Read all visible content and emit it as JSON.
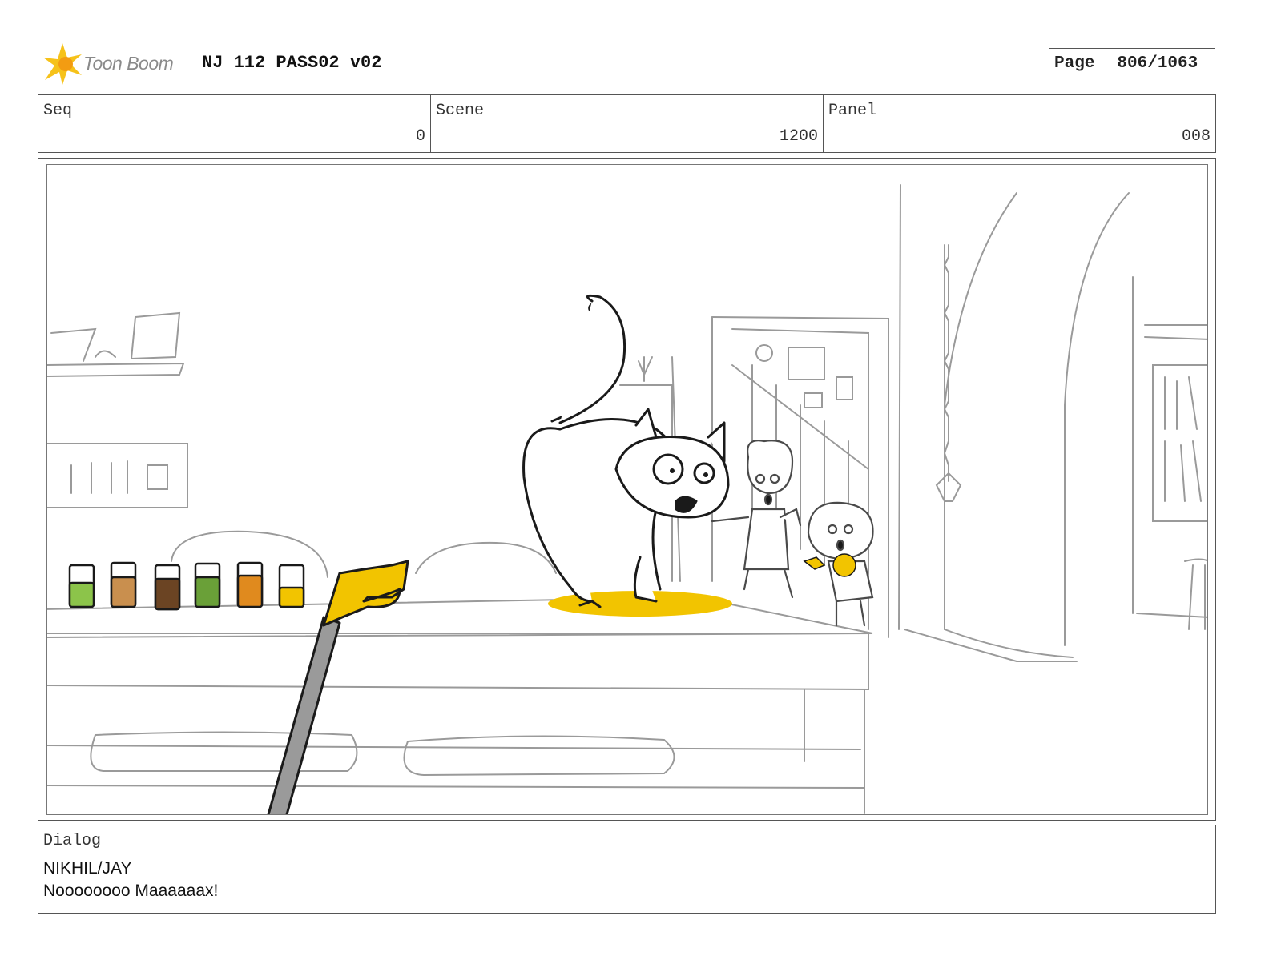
{
  "header": {
    "logo_text": "Toon Boom",
    "title": "NJ 112 PASS02 v02",
    "page_label": "Page",
    "page_value": "806/1063"
  },
  "info": {
    "seq_label": "Seq",
    "seq_value": "0",
    "scene_label": "Scene",
    "scene_value": "1200",
    "panel_label": "Panel",
    "panel_value": "008"
  },
  "dialog": {
    "label": "Dialog",
    "character": "NIKHIL/JAY",
    "line": "Noooooooo Maaaaaax!"
  },
  "colors": {
    "accent_yellow": "#f2c400",
    "sketch_gray": "#9a9a9a",
    "ink_black": "#1a1a1a",
    "jar_green": "#8cc44a",
    "jar_tan": "#c98f4e",
    "jar_brown": "#6b4423",
    "jar_olive": "#6aa038",
    "jar_orange": "#e08a1e",
    "jar_yellow": "#f2c400"
  },
  "icons": {
    "logo": "toon-boom-star-icon"
  }
}
